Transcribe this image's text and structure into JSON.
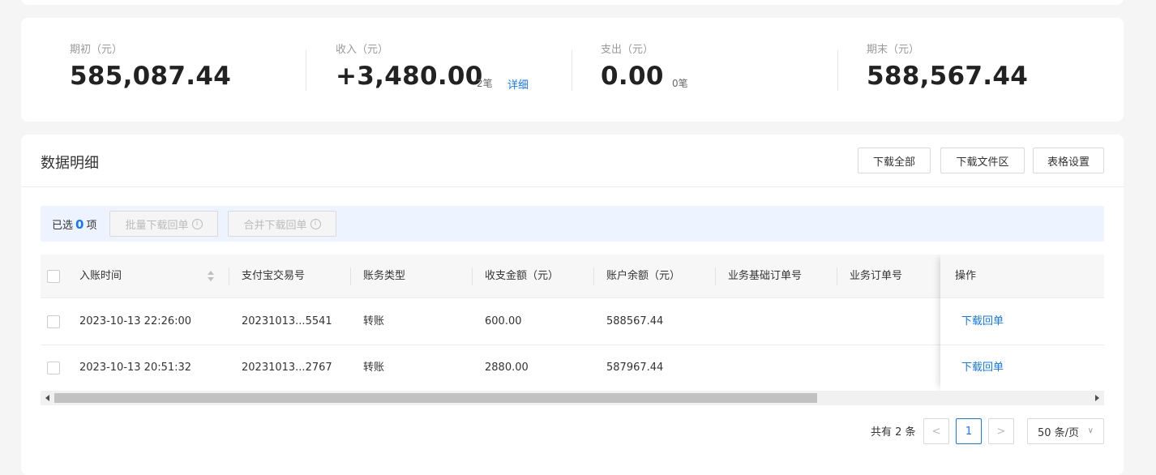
{
  "summary": {
    "opening": {
      "label": "期初（元）",
      "value": "585,087.44"
    },
    "income": {
      "label": "收入（元）",
      "value": "+3,480.00",
      "count": "2笔",
      "detail_link": "详细"
    },
    "expense": {
      "label": "支出（元）",
      "value": "0.00",
      "count": "0笔"
    },
    "closing": {
      "label": "期末（元）",
      "value": "588,567.44"
    }
  },
  "panel": {
    "title": "数据明细",
    "buttons": {
      "download_all": "下载全部",
      "download_files": "下载文件区",
      "table_settings": "表格设置"
    }
  },
  "selection": {
    "prefix": "已选",
    "count": "0",
    "suffix": "项",
    "batch_download": "批量下载回单",
    "merge_download": "合并下载回单",
    "info_glyph": "i"
  },
  "table": {
    "columns": [
      "入账时间",
      "支付宝交易号",
      "账务类型",
      "收支金额（元）",
      "账户余额（元）",
      "业务基础订单号",
      "业务订单号",
      "操作"
    ],
    "rows": [
      {
        "time": "2023-10-13 22:26:00",
        "trade_no": "20231013...5541",
        "type": "转账",
        "amount": "600.00",
        "balance": "588567.44",
        "base_order": "",
        "order": "",
        "action": "下载回单"
      },
      {
        "time": "2023-10-13 20:51:32",
        "trade_no": "20231013...2767",
        "type": "转账",
        "amount": "2880.00",
        "balance": "587967.44",
        "base_order": "",
        "order": "",
        "action": "下载回单"
      }
    ]
  },
  "pagination": {
    "total": "共有 2 条",
    "prev": "<",
    "current": "1",
    "next": ">",
    "page_size": "50 条/页",
    "page_size_chevron": "∨"
  },
  "colors": {
    "accent": "#1677ff",
    "selection_bg": "#eef4ff"
  }
}
